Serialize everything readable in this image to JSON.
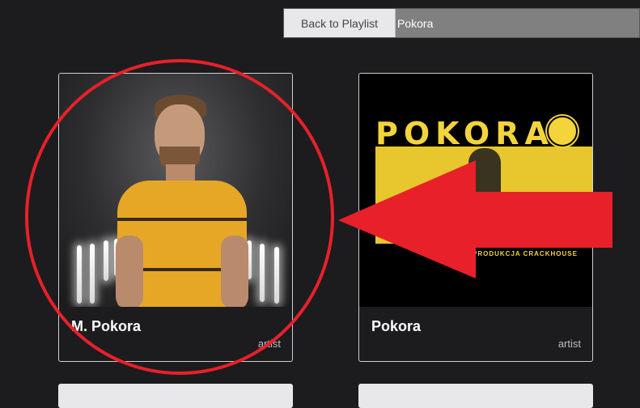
{
  "header": {
    "back_label": "Back to Playlist",
    "search_value": "Pokora"
  },
  "results": [
    {
      "name": "M. Pokora",
      "type": "artist",
      "image": "artist-portrait"
    },
    {
      "name": "Pokora",
      "type": "artist",
      "image": "album-cover",
      "cover_title": "POKORA",
      "cover_subtitle": "PRODUKCJA CRACKHOUSE"
    }
  ],
  "annotation": {
    "color": "#e8202a",
    "shapes": [
      "circle",
      "arrow"
    ]
  }
}
